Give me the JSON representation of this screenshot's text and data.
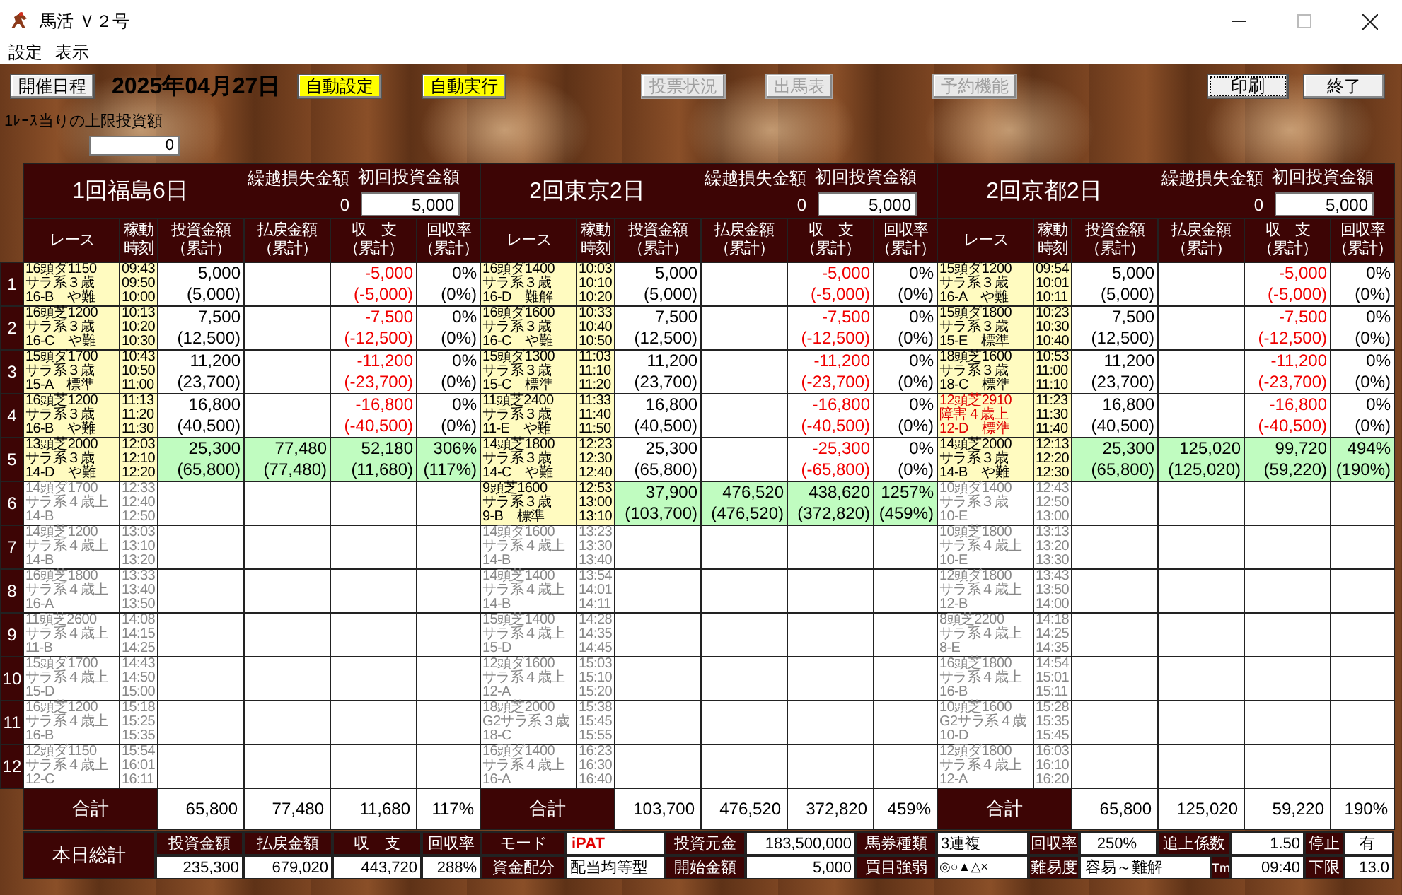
{
  "window": {
    "title": "馬活 Ｖ２号"
  },
  "menu": [
    "設定",
    "表示"
  ],
  "toolbar": {
    "schedule_button": "開催日程",
    "date": "2025年04月27日",
    "buttons": [
      {
        "label": "自動設定",
        "kind": "toggle",
        "on": true
      },
      {
        "label": "自動実行",
        "kind": "toggle",
        "on": true
      },
      {
        "label": "投票状況",
        "kind": "action",
        "disabled": true
      },
      {
        "label": "出馬表",
        "kind": "action",
        "disabled": true
      },
      {
        "label": "予約機能",
        "kind": "action",
        "disabled": true
      }
    ],
    "print_button": "印刷",
    "exit_button": "終了"
  },
  "limit": {
    "label": "1ﾚｰｽ当りの上限投資額",
    "value": "0"
  },
  "race_numbers": [
    "1",
    "2",
    "3",
    "4",
    "5",
    "6",
    "7",
    "8",
    "9",
    "10",
    "11",
    "12"
  ],
  "venues": [
    {
      "title": "1回福島6日",
      "carryover_label": "繰越損失金額",
      "carryover": "0",
      "initial_label": "初回投資金額",
      "initial": "5,000",
      "columns": [
        [
          "レース"
        ],
        [
          "稼動",
          "時刻"
        ],
        [
          "投資金額",
          "（累計）"
        ],
        [
          "払戻金額",
          "（累計）"
        ],
        [
          "収　支",
          "（累計）"
        ],
        [
          "回収率",
          "（累計）"
        ]
      ],
      "races": [
        {
          "info": [
            "16頭ダ1150",
            "サラ系３歳",
            "16-B"
          ],
          "condition": "や難",
          "times": [
            "09:43",
            "09:50",
            "10:00"
          ],
          "settled": true,
          "hit": false,
          "alert": false,
          "invest": "5,000",
          "invest_total": "(5,000)",
          "balance": "-5,000",
          "balance_total": "(-5,000)",
          "loss": true,
          "rate": "0%",
          "rate_total": "(0%)"
        },
        {
          "info": [
            "16頭芝1200",
            "サラ系３歳",
            "16-C"
          ],
          "condition": "や難",
          "times": [
            "10:13",
            "10:20",
            "10:30"
          ],
          "settled": true,
          "hit": false,
          "alert": false,
          "invest": "7,500",
          "invest_total": "(12,500)",
          "balance": "-7,500",
          "balance_total": "(-12,500)",
          "loss": true,
          "rate": "0%",
          "rate_total": "(0%)"
        },
        {
          "info": [
            "15頭ダ1700",
            "サラ系３歳",
            "15-A"
          ],
          "condition": "標準",
          "times": [
            "10:43",
            "10:50",
            "11:00"
          ],
          "settled": true,
          "hit": false,
          "alert": false,
          "invest": "11,200",
          "invest_total": "(23,700)",
          "balance": "-11,200",
          "balance_total": "(-23,700)",
          "loss": true,
          "rate": "0%",
          "rate_total": "(0%)"
        },
        {
          "info": [
            "16頭芝1200",
            "サラ系３歳",
            "16-B"
          ],
          "condition": "や難",
          "times": [
            "11:13",
            "11:20",
            "11:30"
          ],
          "settled": true,
          "hit": false,
          "alert": false,
          "invest": "16,800",
          "invest_total": "(40,500)",
          "balance": "-16,800",
          "balance_total": "(-40,500)",
          "loss": true,
          "rate": "0%",
          "rate_total": "(0%)"
        },
        {
          "info": [
            "13頭芝2000",
            "サラ系３歳",
            "14-D"
          ],
          "condition": "や難",
          "times": [
            "12:03",
            "12:10",
            "12:20"
          ],
          "settled": true,
          "hit": true,
          "alert": false,
          "invest": "25,300",
          "invest_total": "(65,800)",
          "payout": "77,480",
          "payout_total": "(77,480)",
          "balance": "52,180",
          "balance_total": "(11,680)",
          "loss": false,
          "rate": "306%",
          "rate_total": "(117%)"
        },
        {
          "info": [
            "14頭ダ1700",
            "サラ系４歳上",
            "14-B"
          ],
          "times": [
            "12:33",
            "12:40",
            "12:50"
          ],
          "settled": false,
          "hit": false,
          "alert": false
        },
        {
          "info": [
            "14頭芝1200",
            "サラ系４歳上",
            "14-B"
          ],
          "times": [
            "13:03",
            "13:10",
            "13:20"
          ],
          "settled": false,
          "hit": false,
          "alert": false
        },
        {
          "info": [
            "16頭芝1800",
            "サラ系４歳上",
            "16-A"
          ],
          "times": [
            "13:33",
            "13:40",
            "13:50"
          ],
          "settled": false,
          "hit": false,
          "alert": false
        },
        {
          "info": [
            "11頭芝2600",
            "サラ系４歳上",
            "11-B"
          ],
          "times": [
            "14:08",
            "14:15",
            "14:25"
          ],
          "settled": false,
          "hit": false,
          "alert": false
        },
        {
          "info": [
            "15頭ダ1700",
            "サラ系４歳上",
            "15-D"
          ],
          "times": [
            "14:43",
            "14:50",
            "15:00"
          ],
          "settled": false,
          "hit": false,
          "alert": false
        },
        {
          "info": [
            "16頭芝1200",
            "サラ系４歳上",
            "16-B"
          ],
          "times": [
            "15:18",
            "15:25",
            "15:35"
          ],
          "settled": false,
          "hit": false,
          "alert": false
        },
        {
          "info": [
            "12頭ダ1150",
            "サラ系４歳上",
            "12-C"
          ],
          "times": [
            "15:54",
            "16:01",
            "16:11"
          ],
          "settled": false,
          "hit": false,
          "alert": false
        }
      ],
      "total": {
        "label": "合計",
        "invest": "65,800",
        "payout": "77,480",
        "balance": "11,680",
        "rate": "117%"
      }
    },
    {
      "title": "2回東京2日",
      "carryover_label": "繰越損失金額",
      "carryover": "0",
      "initial_label": "初回投資金額",
      "initial": "5,000",
      "columns": [
        [
          "レース"
        ],
        [
          "稼動",
          "時刻"
        ],
        [
          "投資金額",
          "（累計）"
        ],
        [
          "払戻金額",
          "（累計）"
        ],
        [
          "収　支",
          "（累計）"
        ],
        [
          "回収率",
          "（累計）"
        ]
      ],
      "races": [
        {
          "info": [
            "16頭ダ1400",
            "サラ系３歳",
            "16-D"
          ],
          "condition": "難解",
          "times": [
            "10:03",
            "10:10",
            "10:20"
          ],
          "settled": true,
          "hit": false,
          "alert": false,
          "invest": "5,000",
          "invest_total": "(5,000)",
          "balance": "-5,000",
          "balance_total": "(-5,000)",
          "loss": true,
          "rate": "0%",
          "rate_total": "(0%)"
        },
        {
          "info": [
            "16頭ダ1600",
            "サラ系３歳",
            "16-C"
          ],
          "condition": "や難",
          "times": [
            "10:33",
            "10:40",
            "10:50"
          ],
          "settled": true,
          "hit": false,
          "alert": false,
          "invest": "7,500",
          "invest_total": "(12,500)",
          "balance": "-7,500",
          "balance_total": "(-12,500)",
          "loss": true,
          "rate": "0%",
          "rate_total": "(0%)"
        },
        {
          "info": [
            "15頭ダ1300",
            "サラ系３歳",
            "15-C"
          ],
          "condition": "標準",
          "times": [
            "11:03",
            "11:10",
            "11:20"
          ],
          "settled": true,
          "hit": false,
          "alert": false,
          "invest": "11,200",
          "invest_total": "(23,700)",
          "balance": "-11,200",
          "balance_total": "(-23,700)",
          "loss": true,
          "rate": "0%",
          "rate_total": "(0%)"
        },
        {
          "info": [
            "11頭芝2400",
            "サラ系３歳",
            "11-E"
          ],
          "condition": "や難",
          "times": [
            "11:33",
            "11:40",
            "11:50"
          ],
          "settled": true,
          "hit": false,
          "alert": false,
          "invest": "16,800",
          "invest_total": "(40,500)",
          "balance": "-16,800",
          "balance_total": "(-40,500)",
          "loss": true,
          "rate": "0%",
          "rate_total": "(0%)"
        },
        {
          "info": [
            "14頭芝1800",
            "サラ系３歳",
            "14-C"
          ],
          "condition": "や難",
          "times": [
            "12:23",
            "12:30",
            "12:40"
          ],
          "settled": true,
          "hit": false,
          "alert": false,
          "invest": "25,300",
          "invest_total": "(65,800)",
          "balance": "-25,300",
          "balance_total": "(-65,800)",
          "loss": true,
          "rate": "0%",
          "rate_total": "(0%)"
        },
        {
          "info": [
            "9頭芝1600",
            "サラ系３歳",
            "9-B"
          ],
          "condition": "標準",
          "times": [
            "12:53",
            "13:00",
            "13:10"
          ],
          "settled": true,
          "hit": true,
          "alert": false,
          "invest": "37,900",
          "invest_total": "(103,700)",
          "payout": "476,520",
          "payout_total": "(476,520)",
          "balance": "438,620",
          "balance_total": "(372,820)",
          "loss": false,
          "rate": "1257%",
          "rate_total": "(459%)"
        },
        {
          "info": [
            "14頭ダ1600",
            "サラ系４歳上",
            "14-B"
          ],
          "times": [
            "13:23",
            "13:30",
            "13:40"
          ],
          "settled": false,
          "hit": false,
          "alert": false
        },
        {
          "info": [
            "14頭芝1400",
            "サラ系４歳上",
            "14-B"
          ],
          "times": [
            "13:54",
            "14:01",
            "14:11"
          ],
          "settled": false,
          "hit": false,
          "alert": false
        },
        {
          "info": [
            "15頭芝1400",
            "サラ系４歳上",
            "15-D"
          ],
          "times": [
            "14:28",
            "14:35",
            "14:45"
          ],
          "settled": false,
          "hit": false,
          "alert": false
        },
        {
          "info": [
            "12頭ダ1600",
            "サラ系４歳上",
            "12-A"
          ],
          "times": [
            "15:03",
            "15:10",
            "15:20"
          ],
          "settled": false,
          "hit": false,
          "alert": false
        },
        {
          "info": [
            "18頭芝2000",
            "G2サラ系３歳",
            "18-C"
          ],
          "times": [
            "15:38",
            "15:45",
            "15:55"
          ],
          "settled": false,
          "hit": false,
          "alert": false
        },
        {
          "info": [
            "16頭ダ1400",
            "サラ系４歳上",
            "16-A"
          ],
          "times": [
            "16:23",
            "16:30",
            "16:40"
          ],
          "settled": false,
          "hit": false,
          "alert": false
        }
      ],
      "total": {
        "label": "合計",
        "invest": "103,700",
        "payout": "476,520",
        "balance": "372,820",
        "rate": "459%"
      }
    },
    {
      "title": "2回京都2日",
      "carryover_label": "繰越損失金額",
      "carryover": "0",
      "initial_label": "初回投資金額",
      "initial": "5,000",
      "columns": [
        [
          "レース"
        ],
        [
          "稼動",
          "時刻"
        ],
        [
          "投資金額",
          "（累計）"
        ],
        [
          "払戻金額",
          "（累計）"
        ],
        [
          "収　支",
          "（累計）"
        ],
        [
          "回収率",
          "（累計）"
        ]
      ],
      "races": [
        {
          "info": [
            "15頭ダ1200",
            "サラ系３歳",
            "16-A"
          ],
          "condition": "や難",
          "times": [
            "09:54",
            "10:01",
            "10:11"
          ],
          "settled": true,
          "hit": false,
          "alert": false,
          "invest": "5,000",
          "invest_total": "(5,000)",
          "balance": "-5,000",
          "balance_total": "(-5,000)",
          "loss": true,
          "rate": "0%",
          "rate_total": "(0%)"
        },
        {
          "info": [
            "15頭ダ1800",
            "サラ系３歳",
            "15-E"
          ],
          "condition": "標準",
          "times": [
            "10:23",
            "10:30",
            "10:40"
          ],
          "settled": true,
          "hit": false,
          "alert": false,
          "invest": "7,500",
          "invest_total": "(12,500)",
          "balance": "-7,500",
          "balance_total": "(-12,500)",
          "loss": true,
          "rate": "0%",
          "rate_total": "(0%)"
        },
        {
          "info": [
            "18頭芝1600",
            "サラ系３歳",
            "18-C"
          ],
          "condition": "標準",
          "times": [
            "10:53",
            "11:00",
            "11:10"
          ],
          "settled": true,
          "hit": false,
          "alert": false,
          "invest": "11,200",
          "invest_total": "(23,700)",
          "balance": "-11,200",
          "balance_total": "(-23,700)",
          "loss": true,
          "rate": "0%",
          "rate_total": "(0%)"
        },
        {
          "info": [
            "12頭芝2910",
            "障害４歳上",
            "12-D"
          ],
          "condition": "標準",
          "times": [
            "11:23",
            "11:30",
            "11:40"
          ],
          "settled": true,
          "hit": false,
          "alert": true,
          "invest": "16,800",
          "invest_total": "(40,500)",
          "balance": "-16,800",
          "balance_total": "(-40,500)",
          "loss": true,
          "rate": "0%",
          "rate_total": "(0%)"
        },
        {
          "info": [
            "14頭芝2000",
            "サラ系３歳",
            "14-B"
          ],
          "condition": "や難",
          "times": [
            "12:13",
            "12:20",
            "12:30"
          ],
          "settled": true,
          "hit": true,
          "alert": false,
          "invest": "25,300",
          "invest_total": "(65,800)",
          "payout": "125,020",
          "payout_total": "(125,020)",
          "balance": "99,720",
          "balance_total": "(59,220)",
          "loss": false,
          "rate": "494%",
          "rate_total": "(190%)"
        },
        {
          "info": [
            "10頭ダ1400",
            "サラ系３歳",
            "10-E"
          ],
          "times": [
            "12:43",
            "12:50",
            "13:00"
          ],
          "settled": false,
          "hit": false,
          "alert": false
        },
        {
          "info": [
            "10頭芝1800",
            "サラ系４歳上",
            "10-E"
          ],
          "times": [
            "13:13",
            "13:20",
            "13:30"
          ],
          "settled": false,
          "hit": false,
          "alert": false
        },
        {
          "info": [
            "12頭ダ1800",
            "サラ系４歳上",
            "12-B"
          ],
          "times": [
            "13:43",
            "13:50",
            "14:00"
          ],
          "settled": false,
          "hit": false,
          "alert": false
        },
        {
          "info": [
            "8頭芝2200",
            "サラ系４歳上",
            "8-E"
          ],
          "times": [
            "14:18",
            "14:25",
            "14:35"
          ],
          "settled": false,
          "hit": false,
          "alert": false
        },
        {
          "info": [
            "16頭芝1800",
            "サラ系４歳上",
            "16-B"
          ],
          "times": [
            "14:54",
            "15:01",
            "15:11"
          ],
          "settled": false,
          "hit": false,
          "alert": false
        },
        {
          "info": [
            "10頭芝1600",
            "G2サラ系４歳",
            "10-D"
          ],
          "times": [
            "15:28",
            "15:35",
            "15:45"
          ],
          "settled": false,
          "hit": false,
          "alert": false
        },
        {
          "info": [
            "12頭ダ1800",
            "サラ系４歳上",
            "12-A"
          ],
          "times": [
            "16:03",
            "16:10",
            "16:20"
          ],
          "settled": false,
          "hit": false,
          "alert": false
        }
      ],
      "total": {
        "label": "合計",
        "invest": "65,800",
        "payout": "125,020",
        "balance": "59,220",
        "rate": "190%"
      }
    }
  ],
  "day_total": {
    "title": "本日総計",
    "columns": [
      "投資金額",
      "払戻金額",
      "収　支",
      "回収率"
    ],
    "values": [
      "235,300",
      "679,020",
      "443,720",
      "288%"
    ]
  },
  "settings": {
    "mode": {
      "label": "モード",
      "value": "iPAT"
    },
    "allocation": {
      "label": "資金配分",
      "value": "配当均等型"
    },
    "capital": {
      "label": "投資元金",
      "value": "183,500,000"
    },
    "start_amount": {
      "label": "開始金額",
      "value": "5,000"
    },
    "bet_type": {
      "label": "馬券種類",
      "value": "3連複"
    },
    "bet_strength": {
      "label": "買目強弱",
      "value": "◎○▲△×"
    },
    "target_rate": {
      "label": "回収率",
      "value": "250%"
    },
    "difficulty": {
      "label": "難易度",
      "value": "容易～難解"
    },
    "chase_factor": {
      "label": "追上係数",
      "value": "1.50"
    },
    "time": {
      "label": "Tm",
      "value": "09:40"
    },
    "stop": {
      "label": "停止",
      "value": "有"
    },
    "lower_limit": {
      "label": "下限",
      "value": "13.0"
    }
  }
}
